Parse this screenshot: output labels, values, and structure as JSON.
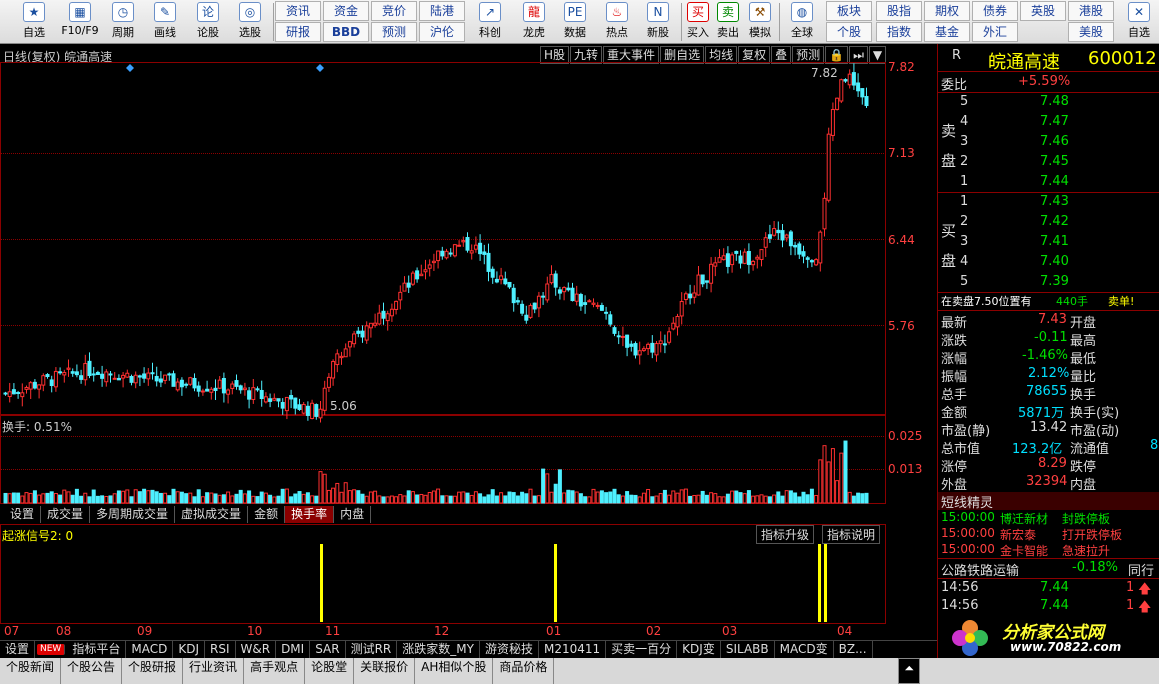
{
  "toolbar": {
    "buttons": [
      {
        "label": "自选",
        "icon": "star-icon"
      },
      {
        "label": "F10/F9",
        "icon": "grid-icon"
      },
      {
        "label": "周期",
        "icon": "clock-icon"
      },
      {
        "label": "画线",
        "icon": "pencil-icon"
      },
      {
        "label": "论股",
        "icon": "discuss-icon"
      },
      {
        "label": "选股",
        "icon": "search-icon"
      },
      {
        "label": "科创",
        "icon": "chart-icon"
      },
      {
        "label": "龙虎",
        "icon": "dragon-icon"
      },
      {
        "label": "数据",
        "icon": "pe-icon"
      },
      {
        "label": "热点",
        "icon": "fire-icon"
      },
      {
        "label": "新股",
        "icon": "newstock-icon"
      },
      {
        "label": "买入",
        "icon": "buy-icon"
      },
      {
        "label": "卖出",
        "icon": "sell-icon"
      },
      {
        "label": "模拟",
        "icon": "hammer-icon"
      },
      {
        "label": "全球",
        "icon": "globe-icon"
      },
      {
        "label": "自选",
        "icon": "more-icon"
      }
    ],
    "grid1": [
      "资讯",
      "资金",
      "竞价",
      "陆港",
      "研报",
      "BBD",
      "预测",
      "沪伦"
    ],
    "grid2": [
      "板块",
      "股指",
      "期权",
      "债券",
      "英股",
      "港股",
      "个股",
      "指数",
      "基金",
      "外汇",
      "美股"
    ],
    "buy_glyph": "买",
    "sell_glyph": "卖"
  },
  "chart": {
    "title": "日线(复权)  皖通高速",
    "menu": [
      "H股",
      "九转",
      "重大事件",
      "删自选",
      "均线",
      "复权",
      "叠",
      "预测",
      "🔒",
      "⏭",
      "▼"
    ],
    "price_labels": [
      "7.82",
      "7.13",
      "6.44",
      "5.76"
    ],
    "high_label": "7.82",
    "low_label": "5.06",
    "volume_label": "换手: 0.51%",
    "volume_labels": [
      "0.025",
      "0.013"
    ],
    "tabs": [
      "设置",
      "成交量",
      "多周期成交量",
      "虚拟成交量",
      "金额",
      "换手率",
      "内盘"
    ],
    "signal_label": "起涨信号2: 0",
    "signal_buttons": [
      "指标升级",
      "指标说明"
    ],
    "dates": [
      "07",
      "08",
      "09",
      "10",
      "11",
      "12",
      "01",
      "02",
      "03",
      "04"
    ]
  },
  "chart_data": {
    "type": "candlestick",
    "high": 7.82,
    "low": 5.06,
    "y_ticks": [
      7.82,
      7.13,
      6.44,
      5.76
    ],
    "volume_ticks": [
      0.025,
      0.013
    ],
    "x_ticks": [
      "07",
      "08",
      "09",
      "10",
      "11",
      "12",
      "01",
      "02",
      "03",
      "04"
    ],
    "signals": [
      {
        "x": "11",
        "value": 1
      },
      {
        "x": "01",
        "value": 1
      },
      {
        "x": "04",
        "value": 1
      },
      {
        "x": "04",
        "value": 1
      }
    ]
  },
  "bottombar": [
    "设置",
    "NEW",
    "指标平台",
    "MACD",
    "KDJ",
    "RSI",
    "W&R",
    "DMI",
    "SAR",
    "测试RR",
    "涨跌家数_MY",
    "游资秘技",
    "M210411",
    "买卖一百分",
    "KDJ变",
    "SILABB",
    "MACD变",
    "BZ..."
  ],
  "footer": [
    "个股新闻",
    "个股公告",
    "个股研报",
    "行业资讯",
    "高手观点",
    "论股堂",
    "关联报价",
    "AH相似个股",
    "商品价格"
  ],
  "quote": {
    "r": "R",
    "name": "皖通高速",
    "code": "600012",
    "weibi_label": "委比",
    "weibi": "+5.59%",
    "sell_label": "卖盘",
    "buy_label": "买盘",
    "sell": [
      {
        "n": "5",
        "p": "7.48"
      },
      {
        "n": "4",
        "p": "7.47"
      },
      {
        "n": "3",
        "p": "7.46"
      },
      {
        "n": "2",
        "p": "7.45"
      },
      {
        "n": "1",
        "p": "7.44"
      }
    ],
    "buy": [
      {
        "n": "1",
        "p": "7.43"
      },
      {
        "n": "2",
        "p": "7.42"
      },
      {
        "n": "3",
        "p": "7.41"
      },
      {
        "n": "4",
        "p": "7.40"
      },
      {
        "n": "5",
        "p": "7.39"
      }
    ],
    "notice": "在卖盘7.50位置有",
    "notice_qty": "440手",
    "notice_tag": "卖单!",
    "stats": [
      {
        "l": "最新",
        "v": "7.43",
        "r": "开盘",
        "c": "red"
      },
      {
        "l": "涨跌",
        "v": "-0.11",
        "r": "最高",
        "c": "green"
      },
      {
        "l": "涨幅",
        "v": "-1.46%",
        "r": "最低",
        "c": "green"
      },
      {
        "l": "振幅",
        "v": "2.12%",
        "r": "量比",
        "c": "cyan"
      },
      {
        "l": "总手",
        "v": "78655",
        "r": "换手",
        "c": "cyan"
      },
      {
        "l": "金额",
        "v": "5871万",
        "r": "换手(实)",
        "c": "cyan"
      },
      {
        "l": "市盈(静)",
        "v": "13.42",
        "r": "市盈(动)",
        "c": "white"
      },
      {
        "l": "总市值",
        "v": "123.2亿",
        "r": "流通值",
        "c": "cyan"
      },
      {
        "l": "涨停",
        "v": "8.29",
        "r": "跌停",
        "c": "red"
      },
      {
        "l": "外盘",
        "v": "32394",
        "r": "内盘",
        "c": "red"
      }
    ],
    "partial_8": "8",
    "short_title": "短线精灵",
    "events": [
      {
        "t": "15:00:00",
        "s": "博迁新材",
        "e": "封跌停板",
        "c": "green"
      },
      {
        "t": "15:00:00",
        "s": "新宏泰",
        "e": "打开跌停板",
        "c": "red"
      },
      {
        "t": "15:00:00",
        "s": "金卡智能",
        "e": "急速拉升",
        "c": "red"
      }
    ],
    "sector": "公路铁路运输",
    "sector_pct": "-0.18%",
    "sector_more": "同行",
    "ticks": [
      {
        "t": "14:56",
        "p": "7.44",
        "q": "1"
      },
      {
        "t": "14:56",
        "p": "7.44",
        "q": "1"
      }
    ],
    "logo_text": "分析家公式网",
    "logo_url": "www.70822.com"
  }
}
